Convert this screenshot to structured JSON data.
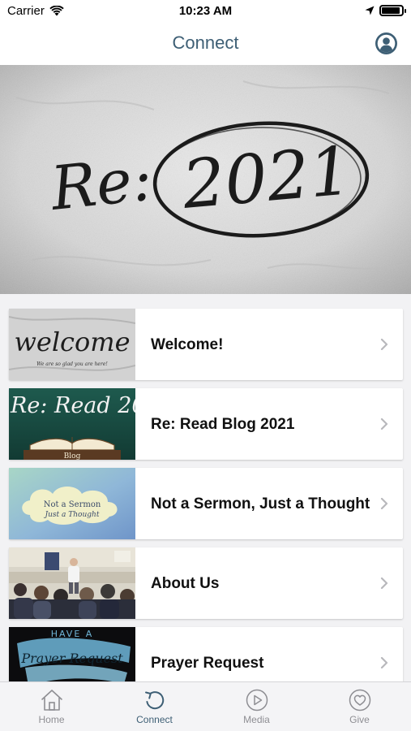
{
  "status_bar": {
    "carrier": "Carrier",
    "time": "10:23 AM",
    "battery_level": 0.9,
    "icons": [
      "wifi-icon",
      "location-arrow-icon",
      "battery-icon"
    ]
  },
  "nav": {
    "title": "Connect",
    "title_color": "#3e5f75",
    "profile_icon": "profile-icon"
  },
  "hero": {
    "text_left": "Re:",
    "text_circled": "2021"
  },
  "items": [
    {
      "label": "Welcome!",
      "thumb_text": "welcome",
      "thumb_subtext": "We are so glad you are here!"
    },
    {
      "label": "Re:  Read Blog 2021",
      "thumb_text": "Re: Read 202",
      "thumb_subtext": "Blog"
    },
    {
      "label": "Not a Sermon, Just a Thought",
      "thumb_text": "Not a Sermon",
      "thumb_subtext": "Just a Thought"
    },
    {
      "label": "About Us"
    },
    {
      "label": "Prayer Request",
      "thumb_text": "HAVE A",
      "thumb_subtext": "Prayer Request"
    }
  ],
  "tabs": [
    {
      "label": "Home",
      "icon": "home-icon",
      "active": false
    },
    {
      "label": "Connect",
      "icon": "connect-icon",
      "active": true
    },
    {
      "label": "Media",
      "icon": "play-circle-icon",
      "active": false
    },
    {
      "label": "Give",
      "icon": "heart-circle-icon",
      "active": false
    }
  ],
  "colors": {
    "accent": "#3e5f75",
    "tab_inactive": "#8e8e93",
    "list_background": "#f2f2f4"
  }
}
